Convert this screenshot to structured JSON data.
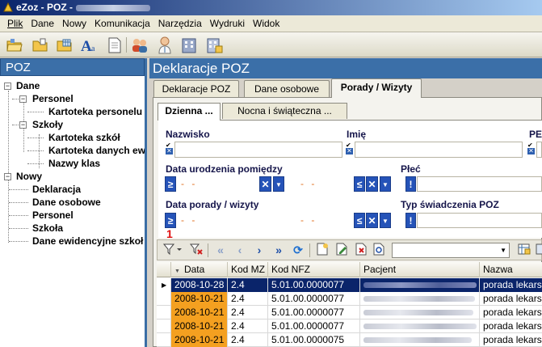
{
  "window": {
    "title": "eZoz - POZ -"
  },
  "menu": [
    "Plik",
    "Dane",
    "Nowy",
    "Komunikacja",
    "Narzędzia",
    "Wydruki",
    "Widok"
  ],
  "toolbar_icons": [
    "open-folder-icon",
    "folder-icon",
    "folder-grid-icon",
    "font-icon",
    "document-icon",
    "users-icon",
    "doctor-icon",
    "building-icon",
    "building-list-icon"
  ],
  "left_pane": {
    "title": "POZ",
    "tree": {
      "dane": "Dane",
      "personel": "Personel",
      "kartoteka_personelu": "Kartoteka personelu",
      "szkoly": "Szkoły",
      "kartoteka_szkol": "Kartoteka szkół",
      "kartoteka_danych_ew": "Kartoteka danych ew",
      "nazwy_klas": "Nazwy klas",
      "nowy": "Nowy",
      "deklaracja": "Deklaracja",
      "dane_osobowe": "Dane osobowe",
      "personel2": "Personel",
      "szkola": "Szkoła",
      "dane_ewidencyjne": "Dane ewidencyjne szkoł"
    }
  },
  "right_pane": {
    "title": "Deklaracje POZ",
    "tabs": [
      "Deklaracje POZ",
      "Dane osobowe",
      "Porady / Wizyty"
    ],
    "active_tab": "Porady / Wizyty",
    "subtabs": [
      "Dzienna ...",
      "Nocna i świąteczna ..."
    ],
    "filters": {
      "nazwisko_label": "Nazwisko",
      "imie_label": "Imię",
      "pesel_label": "PE",
      "data_urodzenia_label": "Data urodzenia pomiędzy",
      "plec_label": "Płeć",
      "data_porady_label": "Data porady / wizyty",
      "typ_swiadczenia_label": "Typ świadczenia POZ",
      "date_placeholder": "- -",
      "cond_symbol": "≥",
      "cond_symbol_end": "≤",
      "x_symbol": "✕",
      "bang": "!"
    },
    "marker": "1"
  },
  "grid": {
    "columns": [
      "Data",
      "Kod MZ",
      "Kod NFZ",
      "Pacjent",
      "Nazwa"
    ],
    "rows": [
      {
        "date": "2008-10-28",
        "kod_mz": "2.4",
        "kod_nfz": "5.01.00.0000077",
        "nazwa": "porada lekarsk",
        "selected": true
      },
      {
        "date": "2008-10-21",
        "kod_mz": "2.4",
        "kod_nfz": "5.01.00.0000077",
        "nazwa": "porada lekarsk",
        "selected": false
      },
      {
        "date": "2008-10-21",
        "kod_mz": "2.4",
        "kod_nfz": "5.01.00.0000077",
        "nazwa": "porada lekarsk",
        "selected": false
      },
      {
        "date": "2008-10-21",
        "kod_mz": "2.4",
        "kod_nfz": "5.01.00.0000077",
        "nazwa": "porada lekarsk",
        "selected": false
      },
      {
        "date": "2008-10-21",
        "kod_mz": "2.4",
        "kod_nfz": "5.01.00.0000075",
        "nazwa": "porada lekarsk",
        "selected": false
      }
    ]
  },
  "colors": {
    "accent": "#3b6fa8",
    "selection": "#0a246a",
    "date_highlight": "#f4a020",
    "title_grad_start": "#0a246a"
  }
}
